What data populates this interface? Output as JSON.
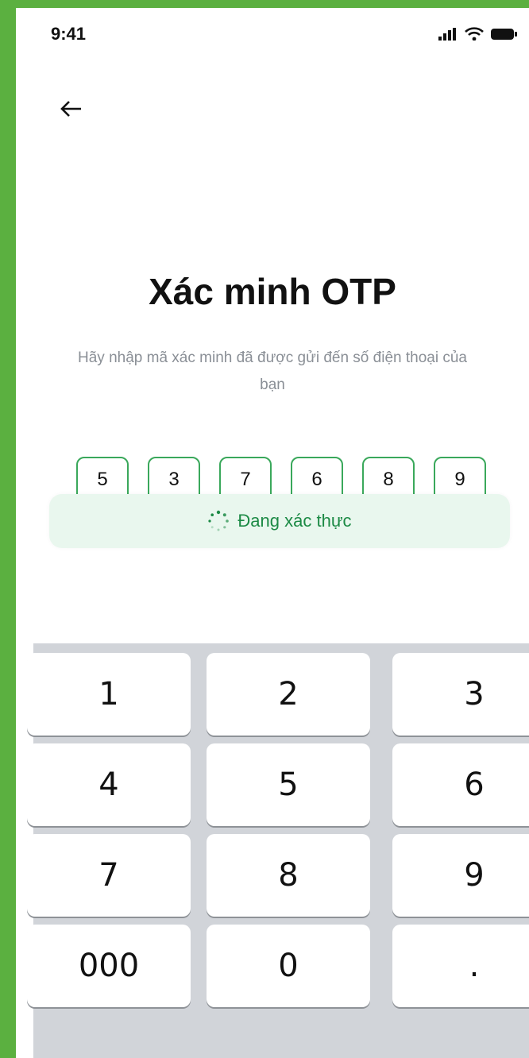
{
  "status_bar": {
    "time": "9:41"
  },
  "header": {
    "back_icon": "arrow-left-icon"
  },
  "page": {
    "title": "Xác minh OTP",
    "subtitle": "Hãy nhập mã xác minh đã được gửi đến số điện thoại của bạn"
  },
  "otp": {
    "digits": [
      "5",
      "3",
      "7",
      "6",
      "8",
      "9"
    ]
  },
  "verifying": {
    "text": "Đang xác thực",
    "icon": "loading-spinner-icon"
  },
  "keypad": {
    "keys": [
      "1",
      "2",
      "3",
      "4",
      "5",
      "6",
      "7",
      "8",
      "9",
      "000",
      "0",
      "."
    ]
  },
  "colors": {
    "background_frame": "#5bb040",
    "accent_green": "#3aa85b",
    "verify_bg": "#e9f7ee",
    "verify_text": "#1c8a45",
    "keypad_bg": "#d1d4d9"
  }
}
